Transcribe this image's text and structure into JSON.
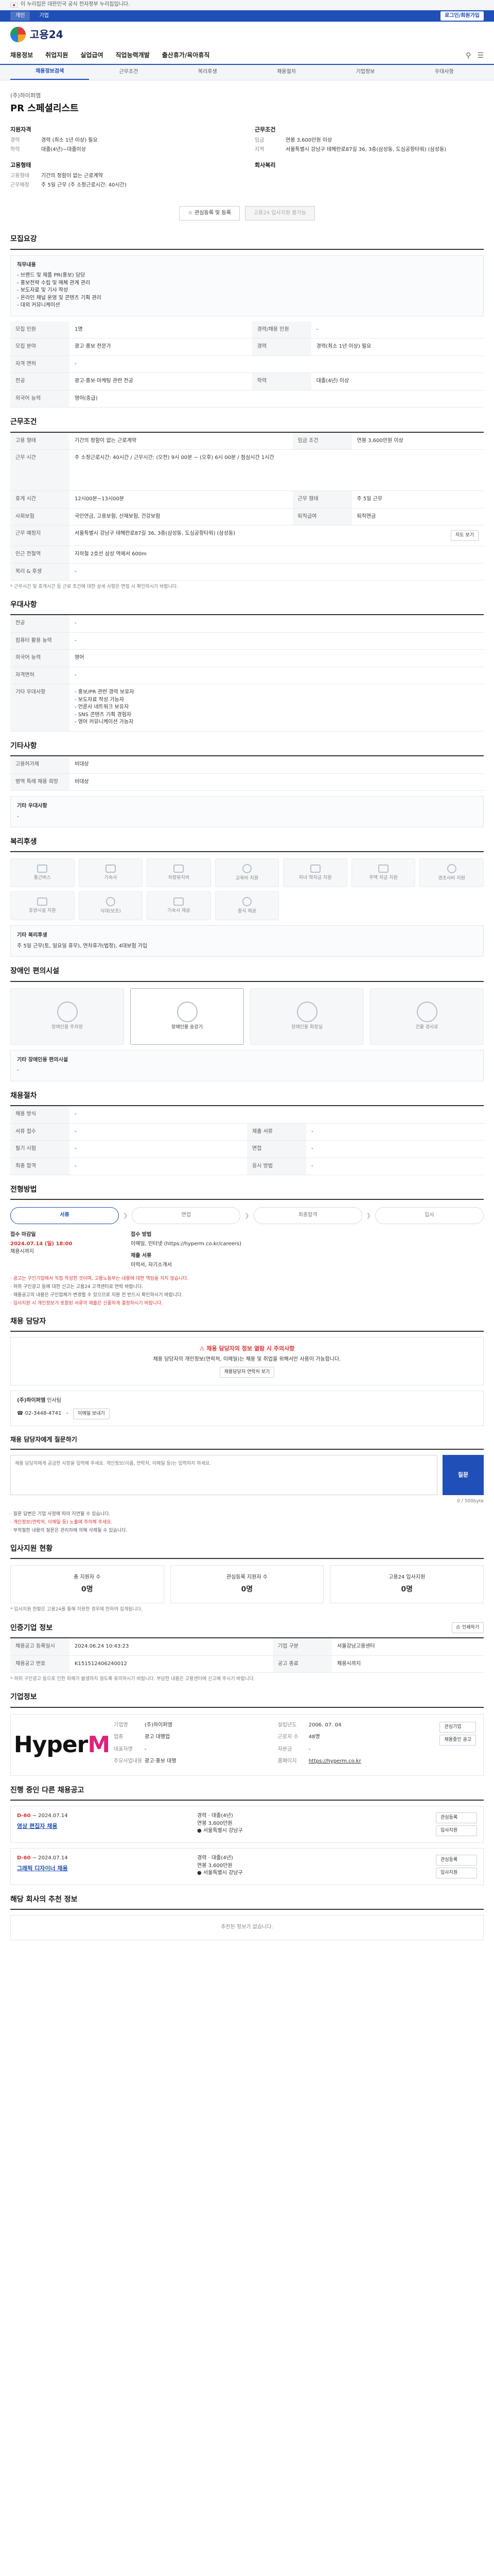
{
  "topbar": {
    "notice": "이 누리집은 대한민국 공식 전자정부 누리집입니다."
  },
  "subbar": {
    "tab1": "개인",
    "tab2": "기업",
    "account": "로그인/회원가입"
  },
  "logo": {
    "text": "고용24"
  },
  "gnb": {
    "items": [
      "채용정보",
      "취업지원",
      "실업급여",
      "직업능력개발",
      "출산휴가/육아휴직"
    ]
  },
  "lnb": {
    "items": [
      "채용정보검색",
      "근무조건",
      "복리후생",
      "채용절차",
      "기업정보",
      "우대사항"
    ]
  },
  "posting": {
    "company": "(주)하이퍼엠",
    "title": "PR 스페셜리스트",
    "summary_left_h": "지원자격",
    "summary_left": [
      {
        "k": "경력",
        "v": "경력 (최소 1년 이상) 필요"
      },
      {
        "k": "학력",
        "v": "대졸(4년)~대졸이상"
      }
    ],
    "summary_left_h2": "고용형태",
    "summary_left2": [
      {
        "k": "고용형태",
        "v": "기간의 정함이 없는 근로계약"
      },
      {
        "k": "근무예정",
        "v": "주 5일 근무 (주 소정근로시간: 40시간)"
      }
    ],
    "summary_right_h": "근무조건",
    "summary_right": [
      {
        "k": "임금",
        "v": "연봉 3,600만원 이상"
      },
      {
        "k": "지역",
        "v": "서울특별시 강남구 테헤란로87길 36, 3층(삼성동, 도심공항타워) (삼성동)"
      }
    ],
    "summary_right_h2": "회사복리",
    "btn_scrap": "관심등록 및 등록",
    "btn_apply": "고용24 입사지원 불가능"
  },
  "recruit": {
    "title": "모집요강",
    "box_title": "직무내용",
    "box_lines": [
      "- 브랜드 및 제품 PR(홍보) 담당",
      "- 홍보전략 수립 및 매체 관계 관리",
      "- 보도자료 및 기사 작성",
      "- 온라인 채널 운영 및 콘텐츠 기획 관리",
      "- 대외 커뮤니케이션"
    ],
    "rows": [
      {
        "k1": "모집 인원",
        "v1": "1명",
        "k2": "경력/채용 인원",
        "v2": "-"
      },
      {
        "k1": "모집 분야",
        "v1": "광고·홍보 전문가",
        "k2": "경력",
        "v2": "경력(최소 1년 이상) 필요"
      },
      {
        "k1": "자격 면허",
        "v1": "-",
        "k2": "",
        "v2": ""
      },
      {
        "k1": "전공",
        "v1": "광고·홍보·마케팅 관련 전공",
        "k2": "학력",
        "v2": "대졸(4년) 이상"
      },
      {
        "k1": "외국어 능력",
        "v1": "영어(중급)",
        "k2": "",
        "v2": ""
      }
    ]
  },
  "workcond": {
    "title": "근무조건",
    "rows": [
      {
        "k": "고용 형태",
        "v": "기간의 정함이 없는 근로계약",
        "k2": "임금 조건",
        "v2": "연봉 3,600만원 이상"
      },
      {
        "k": "근무 시간",
        "v": "주 소정근로시간: 40시간 / 근무시간: (오전) 9시 00분 ~ (오후) 6시 00분 / 점심시간 1시간",
        "k2": "",
        "v2": ""
      },
      {
        "k": "휴게 시간",
        "v": "12시00분~13시00분",
        "k2": "근무 형태",
        "v2": "주 5일 근무"
      },
      {
        "k": "사회보험",
        "v": "국민연금, 고용보험, 산재보험, 건강보험",
        "k2": "퇴직급여",
        "v2": "퇴직연금"
      },
      {
        "k": "근무 예정지",
        "v": "서울특별시 강남구 테헤란로87길 36, 3층(삼성동, 도심공항타워) (삼성동)",
        "k2": "",
        "v2": ""
      },
      {
        "k": "인근 전철역",
        "v": "지하철 2호선 삼성 역에서 600m",
        "k2": "",
        "v2": ""
      },
      {
        "k": "복리 & 후생",
        "v": "-",
        "k2": "",
        "v2": ""
      }
    ],
    "map_btn": "지도 보기",
    "note": "* 근무시간 및 휴게시간 등 근로 조건에 대한 상세 사항은 면접 시 확인하시기 바랍니다."
  },
  "pref": {
    "title": "우대사항",
    "rows": [
      {
        "k": "전공",
        "v": "-"
      },
      {
        "k": "컴퓨터 활용 능력",
        "v": "-"
      },
      {
        "k": "외국어 능력",
        "v": "영어"
      },
      {
        "k": "자격면허",
        "v": "-"
      }
    ],
    "etc_k": "기타 우대사항",
    "etc_lines": [
      "- 홍보/PR 관련 경력 보유자",
      "- 보도자료 작성 가능자",
      "- 언론사 네트워크 보유자",
      "- SNS 콘텐츠 기획 경험자",
      "- 영어 커뮤니케이션 가능자"
    ]
  },
  "etc": {
    "title": "기타사항",
    "rows": [
      {
        "k": "고용허가제",
        "v": "비대상"
      },
      {
        "k": "병역 특례 채용 희망",
        "v": "비대상"
      }
    ],
    "more_h": "기타 우대사항",
    "more_v": "-"
  },
  "welfare": {
    "title": "복리후생",
    "icons": [
      "통근버스",
      "기숙사",
      "차량유지비",
      "교육비 지원",
      "자녀 학자금 지원",
      "주택 자금 지원",
      "경조사비 지원",
      "휴양시설 지원",
      "식대(보조)",
      "기숙사 제공",
      "중식 제공"
    ],
    "sub_h": "기타 복리후생",
    "sub_v": "주 5일 근무(토, 일요일 휴무), 연차휴가(법정), 4대보험 가입"
  },
  "access": {
    "title": "장애인 편의시설",
    "items": [
      "장애인용 주차장",
      "장애인용 승강기",
      "장애인용 화장실",
      "건물 경사로"
    ],
    "sub_h": "기타 장애인용 편의시설",
    "sub_v": "-"
  },
  "process": {
    "title": "채용절차",
    "rows": [
      {
        "k": "채용 방식",
        "v": "-",
        "k2": "",
        "v2": ""
      },
      {
        "k": "서류 접수",
        "v": "-",
        "k2": "제출 서류",
        "v2": "-"
      },
      {
        "k": "필기 시험",
        "v": "-",
        "k2": "면접",
        "v2": "-"
      },
      {
        "k": "최종 합격",
        "v": "-",
        "k2": "응시 방법",
        "v2": "-"
      }
    ]
  },
  "applyInfo": {
    "title": "전형방법",
    "steps": [
      "서류",
      "면접",
      "최종합격",
      "입사"
    ],
    "h1": "접수 마감일",
    "v1": "2024.07.14 (일) 18:00",
    "v1b": "채용시까지",
    "h2": "접수 방법",
    "v2": "이메일, 인터넷 (https://hyperm.co.kr/careers)",
    "h3": "제출 서류",
    "v3": "이력서, 자기소개서",
    "bullets": [
      "· 공고는 구인기업에서 직접 작성한 것이며, 고용노동부는 내용에 대한 책임을 지지 않습니다.",
      "· 허위 구인광고 등에 대한 신고는 고용24 고객센터로 연락 바랍니다.",
      "· 채용공고의 내용은 구인업체가 변경할 수 있으므로 지원 전 반드시 확인하시기 바랍니다.",
      "· 입사지원 시 개인정보가 포함된 서류의 제출은 신중하게 결정하시기 바랍니다."
    ]
  },
  "manager": {
    "title": "채용 담당자",
    "warn_title": "채용 담당자의 정보 열람 시 주의사항",
    "warn_text": "채용 담당자의 개인정보(연락처, 이메일)는 채용 및 취업을 위해서만 사용이 가능합니다.",
    "warn_btn": "채용담당자 연락처 보기",
    "company": "(주)하이퍼엠",
    "dept": "인사팀",
    "phone": "02-3448-4741",
    "fax": "-",
    "email_btn": "이메일 보내기"
  },
  "qna": {
    "title": "채용 담당자에게 질문하기",
    "placeholder": "채용 담당자에게 궁금한 사항을 입력해 주세요. 개인정보(이름, 연락처, 이메일 등)는 입력하지 마세요.",
    "send": "질문",
    "counter": "0 / 500byte",
    "notes": [
      "· 질문 답변은 기업 사정에 따라 지연될 수 있습니다.",
      "· 개인정보(연락처, 이메일 등) 노출에 주의해 주세요.",
      "· 부적절한 내용의 질문은 관리자에 의해 삭제될 수 있습니다."
    ]
  },
  "stats": {
    "title": "입사지원 현황",
    "items": [
      {
        "label": "총 지원자 수",
        "value": "0명"
      },
      {
        "label": "관심등록 지원자 수",
        "value": "0명"
      },
      {
        "label": "고용24 입사지원",
        "value": "0명"
      }
    ],
    "note": "* 입사지원 현황은 고용24를 통해 지원한 경우에 한하여 집계됩니다."
  },
  "meta": {
    "title": "인증기업 정보",
    "print": "인쇄하기",
    "rows": [
      {
        "k": "채용공고 등록일시",
        "v": "2024.06.24 10:43:23",
        "k2": "기업 구분",
        "v2": "서울강남고용센터"
      },
      {
        "k": "채용공고 번호",
        "v": "K151512406240012",
        "k2": "공고 종료",
        "v2": "채용시까지"
      }
    ],
    "note": "* 허위 구인광고 등으로 인한 피해가 발생하지 않도록 유의하시기 바랍니다. 부당한 내용은 고용센터에 신고해 주시기 바랍니다."
  },
  "corp": {
    "title": "기업정보",
    "logo_a": "Hyper",
    "logo_b": "M",
    "info": [
      {
        "k": "기업명",
        "v": "(주)하이퍼엠"
      },
      {
        "k": "설립년도",
        "v": "2006. 07. 04"
      },
      {
        "k": "업종",
        "v": "광고 대행업"
      },
      {
        "k": "근로자 수",
        "v": "48명"
      },
      {
        "k": "대표자명",
        "v": "-"
      },
      {
        "k": "자본금",
        "v": "-"
      },
      {
        "k": "주요사업내용",
        "v": "광고·홍보 대행"
      },
      {
        "k": "홈페이지",
        "v": "https://hyperm.co.kr"
      }
    ],
    "btn1": "관심기업",
    "btn2": "채용중인 공고"
  },
  "related": {
    "title": "진행 중인 다른 채용공고",
    "jobs": [
      {
        "dday": "D-60",
        "date": "~ 2024.07.14",
        "title": "영상 편집자 채용",
        "cond1": "경력",
        "cond2": "대졸(4년)",
        "cond3": "연봉 3,600만원",
        "loc": "서울특별시 강남구",
        "b1": "관심등록",
        "b2": "입사지원"
      },
      {
        "dday": "D-60",
        "date": "~ 2024.07.14",
        "title": "그래픽 디자이너 채용",
        "cond1": "경력",
        "cond2": "대졸(4년)",
        "cond3": "연봉 3,600만원",
        "loc": "서울특별시 강남구",
        "b1": "관심등록",
        "b2": "입사지원"
      }
    ]
  },
  "nearby": {
    "title": "해당 회사의 추천 정보",
    "empty": "추천된 정보가 없습니다."
  }
}
